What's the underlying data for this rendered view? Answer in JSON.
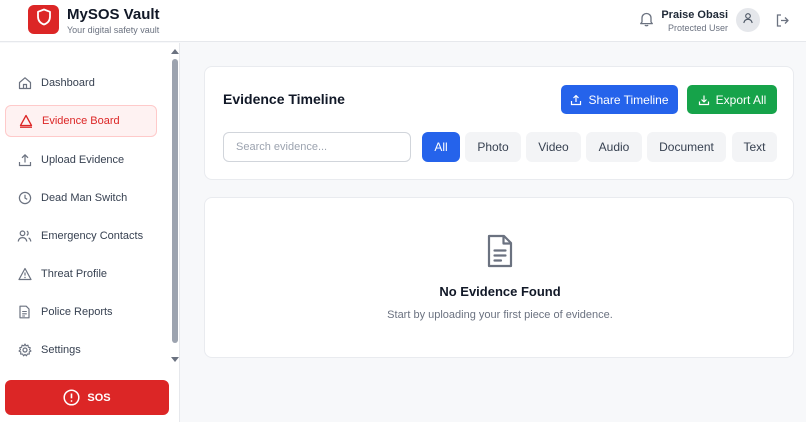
{
  "header": {
    "app_name": "MySOS Vault",
    "tagline": "Your digital safety vault",
    "user_name": "Praise Obasi",
    "user_role": "Protected User",
    "icons": {
      "logo": "shield-icon",
      "notifications": "bell-icon",
      "avatar": "user-icon",
      "logout": "logout-icon"
    }
  },
  "sidebar": {
    "items": [
      {
        "label": "Dashboard",
        "icon": "home-icon",
        "active": false
      },
      {
        "label": "Evidence Board",
        "icon": "warning-triangle-icon",
        "active": true
      },
      {
        "label": "Upload Evidence",
        "icon": "upload-icon",
        "active": false
      },
      {
        "label": "Dead Man Switch",
        "icon": "clock-icon",
        "active": false
      },
      {
        "label": "Emergency Contacts",
        "icon": "users-icon",
        "active": false
      },
      {
        "label": "Threat Profile",
        "icon": "alert-triangle-icon",
        "active": false
      },
      {
        "label": "Police Reports",
        "icon": "file-icon",
        "active": false
      },
      {
        "label": "Settings",
        "icon": "gear-icon",
        "active": false
      }
    ],
    "sos_label": "SOS"
  },
  "main": {
    "title": "Evidence Timeline",
    "share_label": "Share Timeline",
    "export_label": "Export All",
    "search_placeholder": "Search evidence...",
    "filters": [
      "All",
      "Photo",
      "Video",
      "Audio",
      "Document",
      "Text"
    ],
    "active_filter": "All",
    "empty_title": "No Evidence Found",
    "empty_subtitle": "Start by uploading your first piece of evidence."
  },
  "colors": {
    "brand_red": "#dc2626",
    "primary_blue": "#2563eb",
    "success_green": "#16a34a"
  }
}
